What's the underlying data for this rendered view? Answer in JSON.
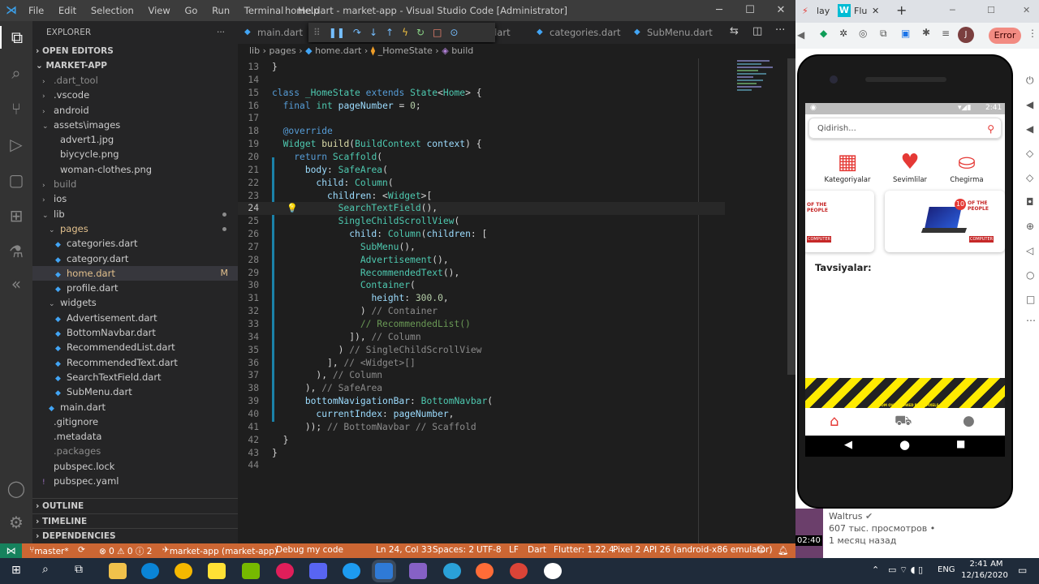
{
  "window": {
    "title": "home.dart - market-app - Visual Studio Code [Administrator]"
  },
  "menu": [
    "File",
    "Edit",
    "Selection",
    "View",
    "Go",
    "Run",
    "Terminal",
    "Help"
  ],
  "tabs": [
    {
      "label": "main.dart"
    },
    {
      "label": "dart"
    },
    {
      "label": "categories.dart"
    },
    {
      "label": "SubMenu.dart"
    }
  ],
  "breadcrumb": [
    "lib",
    "pages",
    "home.dart",
    "_HomeState",
    "build"
  ],
  "explorer": {
    "header": "EXPLORER",
    "open_editors": "OPEN EDITORS",
    "project": "MARKET-APP",
    "items": [
      {
        "label": ".dart_tool",
        "type": "folder",
        "indent": 1,
        "dim": true
      },
      {
        "label": ".vscode",
        "type": "folder",
        "indent": 1
      },
      {
        "label": "android",
        "type": "folder",
        "indent": 1
      },
      {
        "label": "assets\\images",
        "type": "folder-open",
        "indent": 1
      },
      {
        "label": "advert1.jpg",
        "type": "file",
        "indent": 2
      },
      {
        "label": "biycycle.png",
        "type": "file",
        "indent": 2
      },
      {
        "label": "woman-clothes.png",
        "type": "file",
        "indent": 2
      },
      {
        "label": "build",
        "type": "folder",
        "indent": 1,
        "dim": true
      },
      {
        "label": "ios",
        "type": "folder",
        "indent": 1
      },
      {
        "label": "lib",
        "type": "folder-open",
        "indent": 1,
        "dot": true
      },
      {
        "label": "pages",
        "type": "folder-open",
        "indent": 2,
        "orange": true,
        "dot": true
      },
      {
        "label": "categories.dart",
        "type": "dart",
        "indent": 3
      },
      {
        "label": "category.dart",
        "type": "dart",
        "indent": 3
      },
      {
        "label": "home.dart",
        "type": "dart",
        "indent": 3,
        "orange": true,
        "selected": true,
        "badge": "M"
      },
      {
        "label": "profile.dart",
        "type": "dart",
        "indent": 3
      },
      {
        "label": "widgets",
        "type": "folder-open",
        "indent": 2
      },
      {
        "label": "Advertisement.dart",
        "type": "dart",
        "indent": 3
      },
      {
        "label": "BottomNavbar.dart",
        "type": "dart",
        "indent": 3
      },
      {
        "label": "RecommendedList.dart",
        "type": "dart",
        "indent": 3
      },
      {
        "label": "RecommendedText.dart",
        "type": "dart",
        "indent": 3
      },
      {
        "label": "SearchTextField.dart",
        "type": "dart",
        "indent": 3
      },
      {
        "label": "SubMenu.dart",
        "type": "dart",
        "indent": 3
      },
      {
        "label": "main.dart",
        "type": "dart",
        "indent": 2
      },
      {
        "label": ".gitignore",
        "type": "file",
        "indent": 1
      },
      {
        "label": ".metadata",
        "type": "file",
        "indent": 1
      },
      {
        "label": ".packages",
        "type": "file",
        "indent": 1,
        "dim": true
      },
      {
        "label": "pubspec.lock",
        "type": "file",
        "indent": 1
      },
      {
        "label": "pubspec.yaml",
        "type": "yaml",
        "indent": 1
      }
    ],
    "outline": "OUTLINE",
    "timeline": "TIMELINE",
    "dependencies": "DEPENDENCIES"
  },
  "code": [
    {
      "n": 13,
      "html": "<span class='pn'>}</span>"
    },
    {
      "n": 14,
      "html": ""
    },
    {
      "n": 15,
      "html": "<span class='kw'>class</span> <span class='cl'>_HomeState</span> <span class='kw'>extends</span> <span class='cl'>State</span><span class='pn'>&lt;</span><span class='cl'>Home</span><span class='pn'>&gt; {</span>"
    },
    {
      "n": 16,
      "html": "  <span class='kw'>final</span> <span class='cl'>int</span> <span class='vr'>pageNumber</span> <span class='pn'>=</span> <span class='num'>0</span><span class='pn'>;</span>"
    },
    {
      "n": 17,
      "html": ""
    },
    {
      "n": 18,
      "html": "  <span class='ann'>@override</span>"
    },
    {
      "n": 19,
      "html": "  <span class='cl'>Widget</span> <span class='fn'>build</span><span class='pn'>(</span><span class='cl'>BuildContext</span> <span class='vr'>context</span><span class='pn'>) {</span>"
    },
    {
      "n": 20,
      "html": "    <span class='kw'>return</span> <span class='cl'>Scaffold</span><span class='pn'>(</span>"
    },
    {
      "n": 21,
      "html": "      <span class='vr'>body</span><span class='pn'>: </span><span class='cl'>SafeArea</span><span class='pn'>(</span>"
    },
    {
      "n": 22,
      "html": "        <span class='vr'>child</span><span class='pn'>: </span><span class='cl'>Column</span><span class='pn'>(</span>"
    },
    {
      "n": 23,
      "html": "          <span class='vr'>children</span><span class='pn'>: &lt;</span><span class='cl'>Widget</span><span class='pn'>&gt;[</span>"
    },
    {
      "n": 24,
      "html": "            <span class='cl'>SearchTextField</span><span class='pn'>(),</span>"
    },
    {
      "n": 25,
      "html": "            <span class='cl'>SingleChildScrollView</span><span class='pn'>(</span>"
    },
    {
      "n": 26,
      "html": "              <span class='vr'>child</span><span class='pn'>: </span><span class='cl'>Column</span><span class='pn'>(</span><span class='vr'>children</span><span class='pn'>: [</span>"
    },
    {
      "n": 27,
      "html": "                <span class='cl'>SubMenu</span><span class='pn'>(),</span>"
    },
    {
      "n": 28,
      "html": "                <span class='cl'>Advertisement</span><span class='pn'>(),</span>"
    },
    {
      "n": 29,
      "html": "                <span class='cl'>RecommendedText</span><span class='pn'>(),</span>"
    },
    {
      "n": 30,
      "html": "                <span class='cl'>Container</span><span class='pn'>(</span>"
    },
    {
      "n": 31,
      "html": "                  <span class='vr'>height</span><span class='pn'>: </span><span class='num'>300.0</span><span class='pn'>,</span>"
    },
    {
      "n": 32,
      "html": "                <span class='pn'>)</span> <span class='gcm'>// Container</span>"
    },
    {
      "n": 33,
      "html": "                <span class='cm'>// RecommendedList()</span>"
    },
    {
      "n": 34,
      "html": "              <span class='pn'>]),</span> <span class='gcm'>// Column</span>"
    },
    {
      "n": 35,
      "html": "            <span class='pn'>)</span> <span class='gcm'>// SingleChildScrollView</span>"
    },
    {
      "n": 36,
      "html": "          <span class='pn'>],</span> <span class='gcm'>// &lt;Widget&gt;[]</span>"
    },
    {
      "n": 37,
      "html": "        <span class='pn'>),</span> <span class='gcm'>// Column</span>"
    },
    {
      "n": 38,
      "html": "      <span class='pn'>),</span> <span class='gcm'>// SafeArea</span>"
    },
    {
      "n": 39,
      "html": "      <span class='vr'>bottomNavigationBar</span><span class='pn'>: </span><span class='cl'>BottomNavbar</span><span class='pn'>(</span>"
    },
    {
      "n": 40,
      "html": "        <span class='vr'>currentIndex</span><span class='pn'>: </span><span class='vr'>pageNumber</span><span class='pn'>,</span>"
    },
    {
      "n": 41,
      "html": "      <span class='pn'>));</span> <span class='gcm'>// BottomNavbar // Scaffold</span>"
    },
    {
      "n": 42,
      "html": "  <span class='pn'>}</span>"
    },
    {
      "n": 43,
      "html": "<span class='pn'>}</span>"
    },
    {
      "n": 44,
      "html": ""
    }
  ],
  "cursor_line": 24,
  "status": {
    "branch": "master*",
    "problems": "⊗ 0 ⚠ 0 ⓘ 2",
    "project": "market-app (market-app)",
    "debug": "Debug my code",
    "position": "Ln 24, Col 33",
    "spaces": "Spaces: 2",
    "encoding": "UTF-8",
    "eol": "LF",
    "language": "Dart",
    "flutter": "Flutter: 1.22.4",
    "device": "Pixel 2 API 26 (android-x86 emulator)"
  },
  "browser": {
    "tabs": [
      "lay",
      "Flu"
    ],
    "error_button": "Error",
    "avatar_letter": "J"
  },
  "app": {
    "time": "2:41",
    "search_placeholder": "Qidirish...",
    "categories": [
      "Kategoriyalar",
      "Sevimlilar",
      "Chegirma"
    ],
    "ad_text_1": "OF THE PEOPLE",
    "ad_text_2": "COMPUTER",
    "ad_badge": "10",
    "section_title": "Tavsiyalar:",
    "stripe_text": "BOTTOM OVERFLOWED BY 54 PIXELS"
  },
  "youtube": {
    "duration": "02:40",
    "channel": "Waltrus",
    "views": "607 тыс. просмотров •",
    "ago": "1 месяц назад"
  },
  "taskbar": {
    "lang": "ENG",
    "time": "2:41 AM",
    "date": "12/16/2020"
  }
}
